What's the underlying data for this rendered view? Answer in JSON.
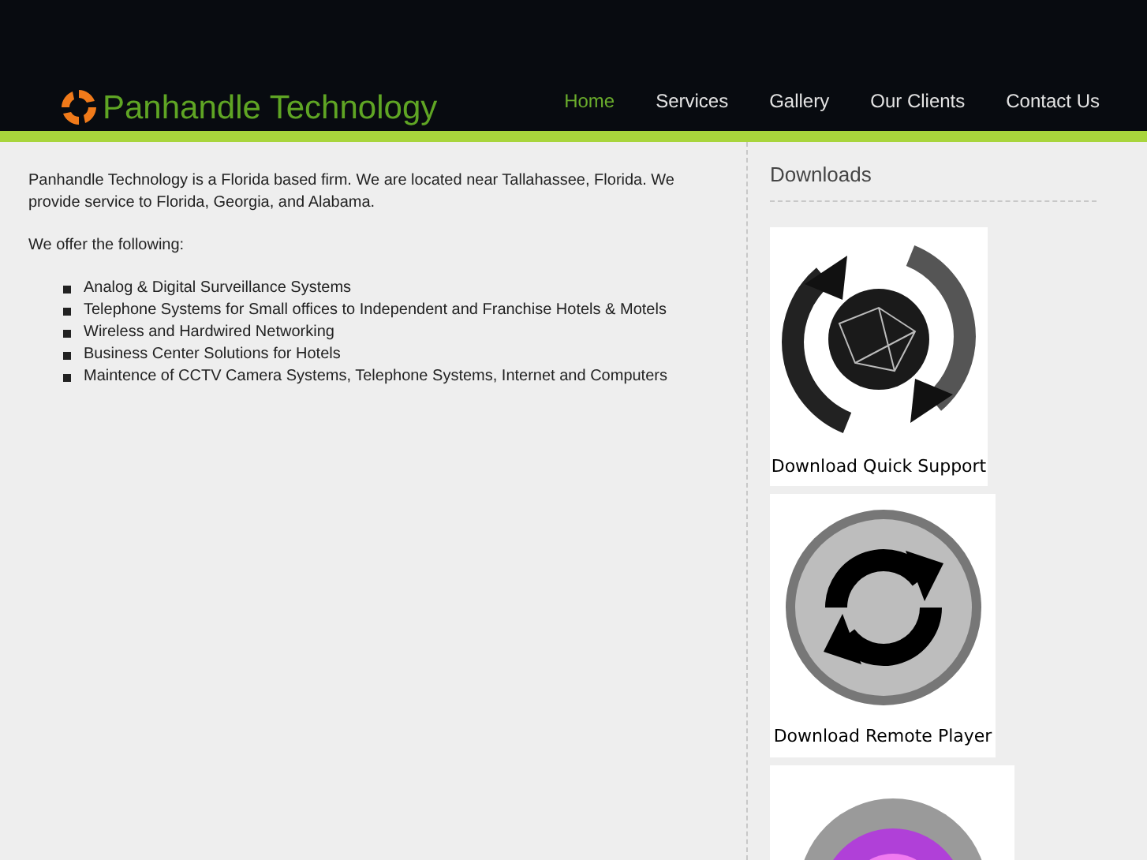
{
  "header": {
    "logo_text": "Panhandle Technology",
    "nav": [
      {
        "label": "Home",
        "selected": true
      },
      {
        "label": "Services",
        "selected": false
      },
      {
        "label": "Gallery",
        "selected": false
      },
      {
        "label": "Our Clients",
        "selected": false
      },
      {
        "label": "Contact Us",
        "selected": false
      }
    ]
  },
  "content": {
    "intro": "Panhandle Technology is a Florida based firm. We are located near Tallahassee, Florida. We provide service to Florida, Georgia, and Alabama.",
    "offer_heading": "We offer the following:",
    "services": [
      "Analog & Digital Surveillance Systems",
      "Telephone Systems for Small offices to Independent and Franchise Hotels & Motels",
      "Wireless and Hardwired Networking",
      "Business Center Solutions for Hotels",
      "Maintence of CCTV Camera Systems, Telephone Systems, Internet and Computers"
    ]
  },
  "sidebar": {
    "title": "Downloads",
    "downloads": [
      {
        "kind": "globe",
        "caption": "Download Quick Support"
      },
      {
        "kind": "sync",
        "caption": "Download Remote Player"
      },
      {
        "kind": "orb"
      }
    ]
  }
}
